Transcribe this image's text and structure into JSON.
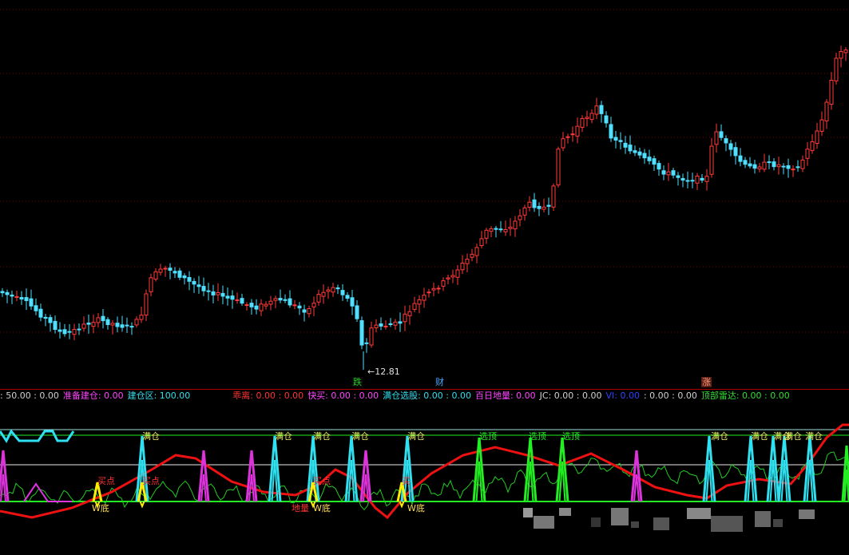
{
  "main": {
    "low_marker": "←12.81",
    "events": [
      {
        "label": "跌",
        "color": "#22cc22",
        "bg": "#0a0a0a"
      },
      {
        "label": "财",
        "color": "#4aa8ff",
        "bg": "#000000"
      },
      {
        "label": "涨",
        "color": "#ff9a7a",
        "bg": "#5a1f16"
      }
    ]
  },
  "legend": [
    {
      "text": ": 50.00 : 0.00",
      "color": "#d0d0d0"
    },
    {
      "text": "准备建仓: 0.00",
      "color": "#ff44ff"
    },
    {
      "text": "建仓区: 100.00",
      "color": "#33ddee"
    },
    {
      "text": "乖离: 0.00 : 0.00",
      "color": "#ff3333"
    },
    {
      "text": "快买: 0.00 : 0.00",
      "color": "#ff44ff"
    },
    {
      "text": "满仓选股: 0.00 : 0.00",
      "color": "#33ddee"
    },
    {
      "text": "百日地量: 0.00",
      "color": "#ff44ff"
    },
    {
      "text": "JC: 0.00 : 0.00",
      "color": "#d0d0d0"
    },
    {
      "text": "VI: 0.00",
      "color": "#2b44ff"
    },
    {
      "text": ": 0.00 : 0.00",
      "color": "#d0d0d0"
    },
    {
      "text": "顶部雷达: 0.00 : 0.00",
      "color": "#33dd33"
    }
  ],
  "labels": {
    "full_position": "满仓",
    "select_top": "选顶",
    "buy_point": "买点",
    "w_bottom": "W底",
    "ground_volume": "地量",
    "buy_short": "买"
  },
  "colors": {
    "up": "#ff3b3b",
    "down": "#4fe0ff",
    "grid": "#7a0000",
    "full": "#2ee0f0",
    "top": "#22ee22",
    "buy": "#ffee00",
    "magenta": "#dd33dd",
    "red_line": "#ee1111",
    "green_line": "#22cc22"
  }
}
